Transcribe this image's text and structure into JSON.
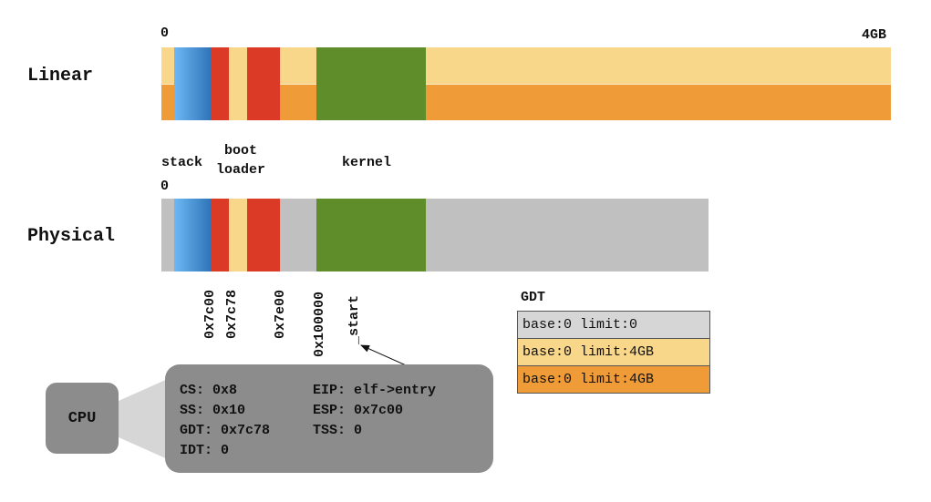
{
  "labels": {
    "linear": "Linear",
    "physical": "Physical",
    "linear_start": "0",
    "linear_end": "4GB",
    "physical_start": "0",
    "stack": "stack",
    "bootloader_line1": "boot",
    "bootloader_line2": "loader",
    "kernel": "kernel"
  },
  "addresses": [
    "0x7c00",
    "0x7c78",
    "0x7e00",
    "0x100000",
    "_start"
  ],
  "colors": {
    "light_orange": "#f8d68a",
    "orange": "#ef9c38",
    "red": "#db3b26",
    "green": "#5f8d2a",
    "gray": "#c0c0c0",
    "blue_light": "#6db8f4",
    "blue_dark": "#2f75b8",
    "cpu_box": "#8c8c8c",
    "cpu_fan": "#d6d6d6"
  },
  "gdt": {
    "title": "GDT",
    "entries": [
      {
        "text": "base:0 limit:0",
        "color": "#d6d6d6"
      },
      {
        "text": "base:0 limit:4GB",
        "color": "#f8d68a"
      },
      {
        "text": "base:0 limit:4GB",
        "color": "#ef9c38"
      }
    ]
  },
  "cpu": {
    "label": "CPU",
    "registers_left": [
      "CS: 0x8",
      "SS: 0x10",
      "GDT: 0x7c78",
      "IDT: 0"
    ],
    "registers_right": [
      "EIP: elf->entry",
      "ESP: 0x7c00",
      "TSS: 0"
    ]
  }
}
